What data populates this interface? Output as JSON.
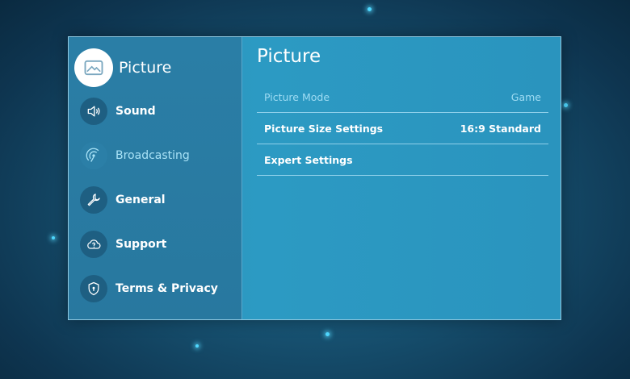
{
  "sidebar": {
    "items": [
      {
        "label": "Picture",
        "icon": "picture-icon",
        "state": "selected"
      },
      {
        "label": "Sound",
        "icon": "speaker-icon",
        "state": "normal"
      },
      {
        "label": "Broadcasting",
        "icon": "broadcast-icon",
        "state": "disabled"
      },
      {
        "label": "General",
        "icon": "wrench-icon",
        "state": "normal"
      },
      {
        "label": "Support",
        "icon": "support-cloud-icon",
        "state": "normal"
      },
      {
        "label": "Terms & Privacy",
        "icon": "shield-icon",
        "state": "normal"
      }
    ]
  },
  "main": {
    "title": "Picture",
    "settings": [
      {
        "label": "Picture Mode",
        "value": "Game",
        "state": "disabled"
      },
      {
        "label": "Picture Size Settings",
        "value": "16:9 Standard",
        "state": "normal"
      },
      {
        "label": "Expert Settings",
        "value": "",
        "state": "normal"
      }
    ]
  },
  "colors": {
    "panel": "#2c9ac3",
    "sidebar": "#2a7ea6",
    "accent_glow": "#4fd8ff",
    "text": "#ffffff",
    "text_disabled": "#a8e2f6"
  }
}
